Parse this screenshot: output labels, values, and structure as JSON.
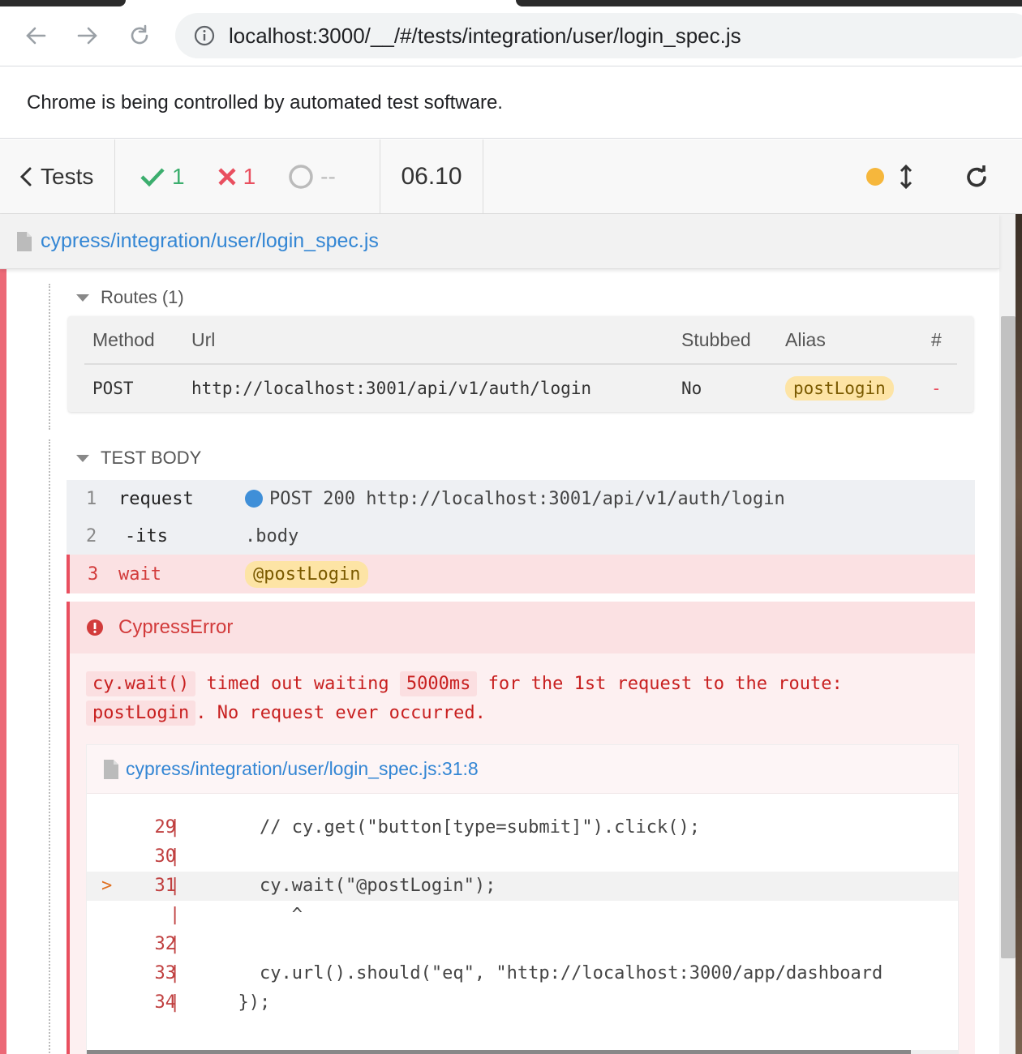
{
  "browser": {
    "url": "localhost:3000/__/#/tests/integration/user/login_spec.js",
    "automation_notice": "Chrome is being controlled by automated test software."
  },
  "reporter": {
    "back_label": "Tests",
    "passed": "1",
    "failed": "1",
    "pending": "--",
    "duration": "06.10",
    "colors": {
      "pass": "#3cae6e",
      "fail": "#e94f5f",
      "running": "#f6b73c"
    }
  },
  "spec": {
    "path": "cypress/integration/user/login_spec.js"
  },
  "routes": {
    "title": "Routes (1)",
    "headers": [
      "Method",
      "Url",
      "Stubbed",
      "Alias",
      "#"
    ],
    "rows": [
      {
        "method": "POST",
        "url": "http://localhost:3001/api/v1/auth/login",
        "stubbed": "No",
        "alias": "postLogin",
        "count": "-"
      }
    ]
  },
  "test_body": {
    "title": "TEST BODY",
    "commands": [
      {
        "num": "1",
        "name": "request",
        "message": "POST 200 http://localhost:3001/api/v1/auth/login"
      },
      {
        "num": "2",
        "name": "-its",
        "message": ".body"
      },
      {
        "num": "3",
        "name": "wait",
        "message": "@postLogin"
      }
    ]
  },
  "error": {
    "name": "CypressError",
    "msg_code1": "cy.wait()",
    "msg_text1": "timed out waiting",
    "msg_code2": "5000ms",
    "msg_text2": "for the 1st request to the route:",
    "msg_code3": "postLogin",
    "msg_text3": ". No request ever occurred.",
    "frame_path": "cypress/integration/user/login_spec.js:31:8",
    "lines": [
      {
        "num": "29",
        "text": "    // cy.get(\"button[type=submit]\").click();"
      },
      {
        "num": "30",
        "text": ""
      },
      {
        "num": "31",
        "text": "    cy.wait(\"@postLogin\");"
      },
      {
        "num": "",
        "text": "       ^"
      },
      {
        "num": "32",
        "text": ""
      },
      {
        "num": "33",
        "text": "    cy.url().should(\"eq\", \"http://localhost:3000/app/dashboard"
      },
      {
        "num": "34",
        "text": "  });"
      }
    ]
  }
}
